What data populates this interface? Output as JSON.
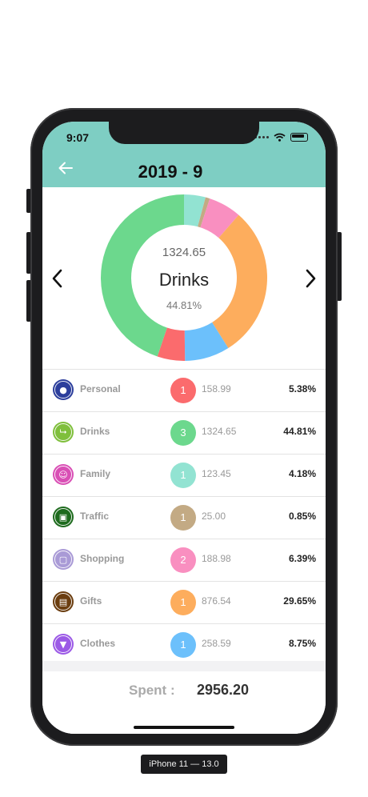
{
  "status": {
    "time": "9:07"
  },
  "header": {
    "title": "2019 - 9"
  },
  "chart_data": {
    "type": "pie",
    "donut": true,
    "center": {
      "amount": "1324.65",
      "category": "Drinks",
      "percent": "44.81%"
    },
    "slices": [
      {
        "name": "Personal",
        "value": 158.99,
        "percent": 5.38,
        "color": "#fb6b6d"
      },
      {
        "name": "Drinks",
        "value": 1324.65,
        "percent": 44.81,
        "color": "#6cd88d"
      },
      {
        "name": "Family",
        "value": 123.45,
        "percent": 4.18,
        "color": "#92e3d2"
      },
      {
        "name": "Traffic",
        "value": 25.0,
        "percent": 0.85,
        "color": "#c3aa84"
      },
      {
        "name": "Shopping",
        "value": 188.98,
        "percent": 6.39,
        "color": "#f98fc0"
      },
      {
        "name": "Gifts",
        "value": 876.54,
        "percent": 29.65,
        "color": "#fdad5d"
      },
      {
        "name": "Clothes",
        "value": 258.59,
        "percent": 8.75,
        "color": "#6cc0fb"
      }
    ]
  },
  "categories": [
    {
      "name": "Personal",
      "count": "1",
      "amount": "158.99",
      "percent": "5.38%",
      "icon": "person-icon",
      "icon_color": "#2c3e9c",
      "color": "#fb6b6d"
    },
    {
      "name": "Drinks",
      "count": "3",
      "amount": "1324.65",
      "percent": "44.81%",
      "icon": "wine-glass-icon",
      "icon_color": "#7fbf3c",
      "color": "#6cd88d"
    },
    {
      "name": "Family",
      "count": "1",
      "amount": "123.45",
      "percent": "4.18%",
      "icon": "family-icon",
      "icon_color": "#d94fb5",
      "color": "#92e3d2"
    },
    {
      "name": "Traffic",
      "count": "1",
      "amount": "25.00",
      "percent": "0.85%",
      "icon": "train-icon",
      "icon_color": "#1e6b1e",
      "color": "#c3aa84"
    },
    {
      "name": "Shopping",
      "count": "2",
      "amount": "188.98",
      "percent": "6.39%",
      "icon": "shopping-bag-icon",
      "icon_color": "#a99ad6",
      "color": "#f98fc0"
    },
    {
      "name": "Gifts",
      "count": "1",
      "amount": "876.54",
      "percent": "29.65%",
      "icon": "gift-icon",
      "icon_color": "#6b3d0f",
      "color": "#fdad5d"
    },
    {
      "name": "Clothes",
      "count": "1",
      "amount": "258.59",
      "percent": "8.75%",
      "icon": "tshirt-icon",
      "icon_color": "#9b59e6",
      "color": "#6cc0fb"
    }
  ],
  "footer": {
    "spent_label": "Spent :",
    "spent_value": "2956.20"
  },
  "device_label": "iPhone 11 — 13.0"
}
